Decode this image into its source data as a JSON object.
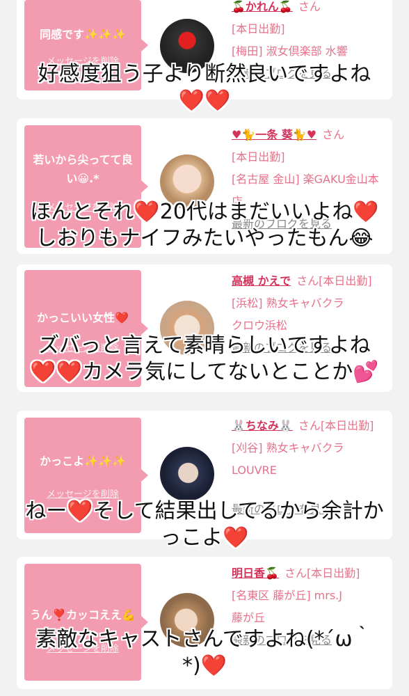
{
  "cards": [
    {
      "message": "同感です✨✨✨",
      "delete_label": "メッセージを削除",
      "name": "🍒かれん🍒",
      "san": "さん",
      "lines": [
        "[本日出勤]",
        "[梅田] 淑女倶楽部 水響"
      ],
      "blog": "最新のブログを見る"
    },
    {
      "message": "若いから尖ってて良い😀.*",
      "delete_label": "メッセージを削除",
      "name": "♥🐈一条 葵🐈♥",
      "san": "さん",
      "lines": [
        "[本日出勤]",
        "[名古屋 金山] 楽GAKU金山本店"
      ],
      "blog": "最新のブログを見る"
    },
    {
      "message": "かっこいい女性❤️",
      "delete_label": "メッセージを削除",
      "name": "高槻 かえで",
      "san": "さん[本日出勤]",
      "lines": [
        "[浜松] 熟女キャバクラ",
        "クロウ浜松"
      ],
      "blog": "最新のブログを見る"
    },
    {
      "message": "かっこよ✨✨✨",
      "delete_label": "メッセージを削除",
      "name": "🐰ちなみ🐰",
      "san": "さん[本日出勤]",
      "lines": [
        "[刈谷] 熟女キャバクラ",
        "LOUVRE"
      ],
      "blog": "最新のブログを見る"
    },
    {
      "message": "うん❣️カッコええ💪",
      "delete_label": "メッセージを削除",
      "name": "明日香🍒",
      "san": "さん[本日出勤]",
      "lines": [
        "[名東区 藤が丘] mrs.J",
        "藤が丘"
      ],
      "blog": "最新のブログを見る"
    }
  ],
  "captions": [
    {
      "line1": "好感度狙う子より断然良いですよね",
      "line2": "❤️❤️"
    },
    {
      "line1": "ほんとそれ❤️20代はまだいいよね❤️",
      "line2": "しおりもナイフみたいやったもん😂"
    },
    {
      "line1": "ズバっと言えて素晴らしいですよね",
      "line2": "❤️❤️カメラ気にしてないとことか💕"
    },
    {
      "line1": "ねー❤️そして結果出してるから余計か",
      "line2": "っこよ❤️"
    },
    {
      "line1": "素敵なキャストさんですよね(*´ω｀",
      "line2": "*)❤️"
    }
  ],
  "colors": {
    "bubble": "#f39bb0",
    "name": "#d3325a",
    "accent": "#e7708a",
    "bg": "#f2f2f2"
  }
}
